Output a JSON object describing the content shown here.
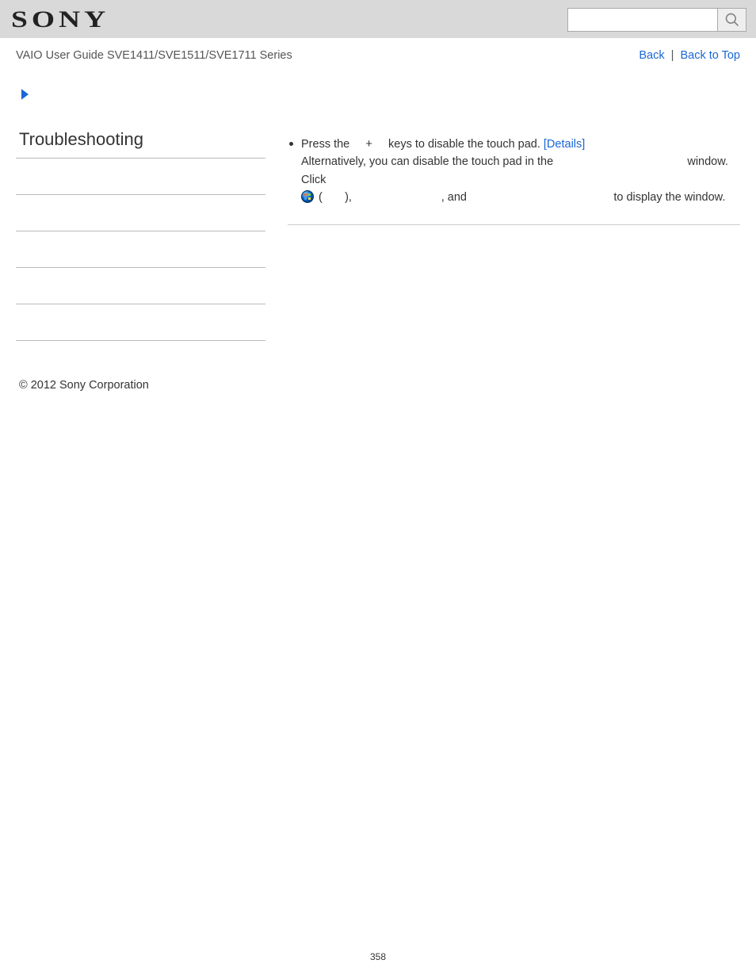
{
  "header": {
    "brand": "SONY",
    "search_placeholder": ""
  },
  "subbar": {
    "guide_title": "VAIO User Guide SVE1411/SVE1511/SVE1711 Series",
    "back_label": "Back",
    "back_to_top_label": "Back to Top",
    "separator": "|"
  },
  "sidebar": {
    "heading": "Troubleshooting"
  },
  "main": {
    "bullet": {
      "t1": "Press the ",
      "t2": " + ",
      "t3": " keys to disable the touch pad. ",
      "details_label": "[Details]",
      "t4": "Alternatively, you can disable the touch pad in the ",
      "t5": " window. Click ",
      "t6": "(",
      "t7": "), ",
      "t8": ", and ",
      "t9": " to display the window."
    }
  },
  "footer": {
    "copyright": "© 2012 Sony Corporation",
    "page_number": "358"
  }
}
